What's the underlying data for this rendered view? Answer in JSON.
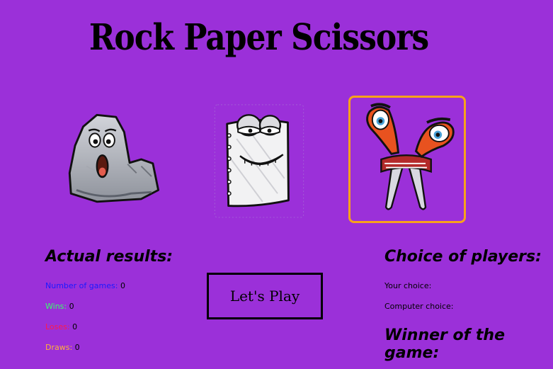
{
  "title": "Rock Paper Scissors",
  "choices": [
    {
      "id": "rock",
      "selected": false
    },
    {
      "id": "paper",
      "selected": false
    },
    {
      "id": "scissors",
      "selected": true
    }
  ],
  "results": {
    "heading": "Actual results:",
    "games_label": "Number of games:",
    "games_value": "0",
    "wins_label": "Wins:",
    "wins_value": "0",
    "loses_label": "Loses:",
    "loses_value": "0",
    "draws_label": "Draws:",
    "draws_value": "0"
  },
  "play_button": "Let's Play",
  "players": {
    "heading": "Choice of players:",
    "your_choice_label": "Your choice:",
    "computer_choice_label": "Computer choice:",
    "winner_heading": "Winner of the game:"
  },
  "colors": {
    "background": "#9b30d9",
    "selected_border": "#f7a21b",
    "games_label": "#1a1aff",
    "wins_label": "#39ff6a",
    "loses_label": "#ff1a4b",
    "draws_label": "#ffb13b"
  },
  "icons": [
    "rock-character-icon",
    "paper-character-icon",
    "scissors-character-icon"
  ]
}
